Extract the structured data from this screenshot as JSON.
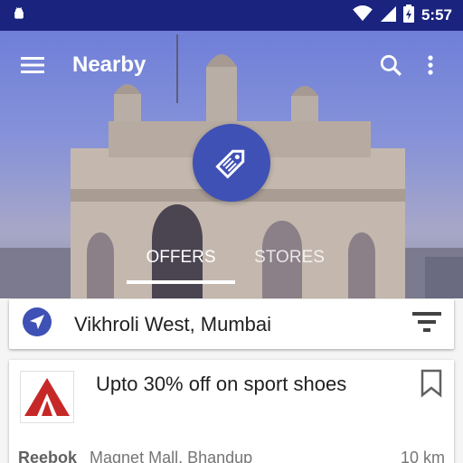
{
  "status": {
    "time": "5:57"
  },
  "toolbar": {
    "title": "Nearby"
  },
  "tabs": [
    {
      "label": "OFFERS",
      "active": true
    },
    {
      "label": "STORES",
      "active": false
    }
  ],
  "location": {
    "text": "Vikhroli West, Mumbai"
  },
  "offer": {
    "title": "Upto 30% off on sport shoes",
    "brand": "Reebok",
    "place": "Magnet Mall, Bhandup",
    "distance": "10 km"
  },
  "colors": {
    "status_bar": "#1a237e",
    "accent": "#3f51b5",
    "brand_red": "#c62828"
  },
  "icons": [
    "android-icon",
    "wifi-icon",
    "signal-icon",
    "battery-icon",
    "menu-icon",
    "search-icon",
    "more-vert-icon",
    "tag-icon",
    "navigation-arrow-icon",
    "filter-icon",
    "reebok-logo",
    "bookmark-icon"
  ]
}
